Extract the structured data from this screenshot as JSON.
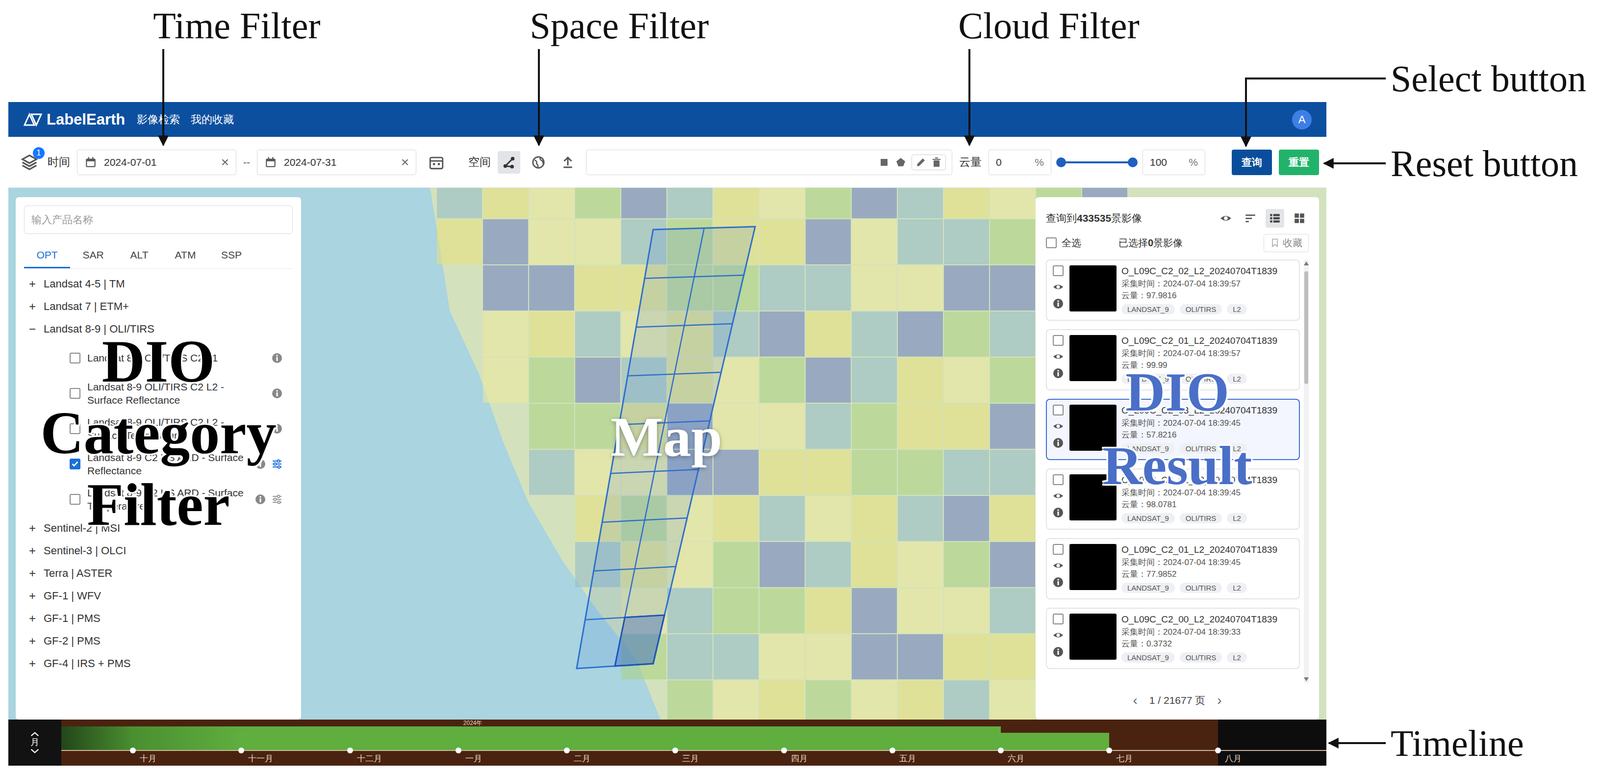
{
  "annotations": {
    "top": [
      {
        "text": "Time Filter"
      },
      {
        "text": "Space Filter"
      },
      {
        "text": "Cloud Filter"
      }
    ],
    "right": [
      {
        "text": "Select button"
      },
      {
        "text": "Reset button"
      },
      {
        "text": "Timeline"
      }
    ],
    "overlays": {
      "category": "DIO Category Filter",
      "map": "Map",
      "result": "DIO Result"
    }
  },
  "header": {
    "logo": "LabelEarth",
    "nav": [
      "影像检索",
      "我的收藏"
    ],
    "avatar": "A"
  },
  "toolbar": {
    "layer_badge": "1",
    "time": {
      "label": "时间",
      "start": "2024-07-01",
      "end": "2024-07-31",
      "separator": "--",
      "clear": "×"
    },
    "space": {
      "label": "空间",
      "modes": [
        {
          "selected": true
        },
        {
          "selected": false
        },
        {
          "selected": false
        }
      ]
    },
    "cloud": {
      "label": "云量",
      "min": "0",
      "max": "100",
      "unit": "%",
      "from": 0,
      "level": 1
    },
    "buttons": {
      "query": "查询",
      "reset": "重置"
    }
  },
  "category": {
    "search_placeholder": "输入产品名称",
    "tabs": [
      {
        "label": "OPT",
        "selected": true
      },
      {
        "label": "SAR",
        "selected": false
      },
      {
        "label": "ALT",
        "selected": false
      },
      {
        "label": "ATM",
        "selected": false
      },
      {
        "label": "SSP",
        "selected": false
      }
    ],
    "groups": [
      {
        "sign": "+",
        "name": "Landsat 4-5 | TM",
        "expanded": false,
        "items": []
      },
      {
        "sign": "+",
        "name": "Landsat 7 | ETM+",
        "expanded": false,
        "items": []
      },
      {
        "sign": "−",
        "name": "Landsat 8-9 | OLI/TIRS",
        "expanded": true,
        "items": [
          {
            "name": "Landsat 8-9 OLI/TIRS C2 L1",
            "checked": false,
            "settings": false
          },
          {
            "name": "Landsat 8-9 OLI/TIRS C2 L2 - Surface Reflectance",
            "checked": false,
            "settings": false
          },
          {
            "name": "Landsat 8-9 OLI/TIRS C2 L2 - Surface Temperature",
            "checked": false,
            "settings": false
          },
          {
            "name": "Landsat 8-9 C2 US ARD - Surface Reflectance",
            "checked": true,
            "settings": true
          },
          {
            "name": "Landsat 8-9 C2 US ARD - Surface Temperature",
            "checked": false,
            "settings": true
          }
        ]
      },
      {
        "sign": "+",
        "name": "Sentinel-2 | MSI",
        "expanded": false,
        "items": []
      },
      {
        "sign": "+",
        "name": "Sentinel-3 | OLCI",
        "expanded": false,
        "items": []
      },
      {
        "sign": "+",
        "name": "Terra | ASTER",
        "expanded": false,
        "items": []
      },
      {
        "sign": "+",
        "name": "GF-1 | WFV",
        "expanded": false,
        "items": []
      },
      {
        "sign": "+",
        "name": "GF-1 | PMS",
        "expanded": false,
        "items": []
      },
      {
        "sign": "+",
        "name": "GF-2 | PMS",
        "expanded": false,
        "items": []
      },
      {
        "sign": "+",
        "name": "GF-4 | IRS + PMS",
        "expanded": false,
        "items": []
      }
    ]
  },
  "results": {
    "count_prefix": "查询到",
    "count": "433535",
    "count_suffix": "景影像",
    "views": [
      {
        "selected": true
      },
      {
        "selected": false
      }
    ],
    "select_all": {
      "label": "全选",
      "checked": false
    },
    "picked_prefix": "已选择",
    "picked": "0",
    "picked_suffix": "景影像",
    "favorite": {
      "label": "收藏",
      "disabled": true
    },
    "time_label": "采集时间：",
    "cloud_label": "云量：",
    "items": [
      {
        "title": "O_L09C_C2_02_L2_20240704T1839",
        "time": "2024-07-04 18:39:57",
        "cloud": "97.9816",
        "tags": [
          "LANDSAT_9",
          "OLI/TIRS",
          "L2"
        ],
        "checked": false,
        "selected": false
      },
      {
        "title": "O_L09C_C2_01_L2_20240704T1839",
        "time": "2024-07-04 18:39:57",
        "cloud": "99.99",
        "tags": [
          "LANDSAT_9",
          "OLI/TIRS",
          "L2"
        ],
        "checked": false,
        "selected": false
      },
      {
        "title": "O_L09C_C2_03_L2_20240704T1839",
        "time": "2024-07-04 18:39:45",
        "cloud": "57.8216",
        "tags": [
          "LANDSAT_9",
          "OLI/TIRS",
          "L2"
        ],
        "checked": false,
        "selected": true
      },
      {
        "title": "O_L09C_C2_02_L2_20240704T1839",
        "time": "2024-07-04 18:39:45",
        "cloud": "98.0781",
        "tags": [
          "LANDSAT_9",
          "OLI/TIRS",
          "L2"
        ],
        "checked": false,
        "selected": false
      },
      {
        "title": "O_L09C_C2_01_L2_20240704T1839",
        "time": "2024-07-04 18:39:45",
        "cloud": "77.9852",
        "tags": [
          "LANDSAT_9",
          "OLI/TIRS",
          "L2"
        ],
        "checked": false,
        "selected": false
      },
      {
        "title": "O_L09C_C2_00_L2_20240704T1839",
        "time": "2024-07-04 18:39:33",
        "cloud": "0.3732",
        "tags": [
          "LANDSAT_9",
          "OLI/TIRS",
          "L2"
        ],
        "checked": false,
        "selected": false
      }
    ],
    "page": {
      "prev": "‹",
      "text": "1 / 21677 页",
      "next": "›"
    }
  },
  "timeline": {
    "unit": "月",
    "months": [
      {
        "label": "十月",
        "level": 0.77,
        "future": false
      },
      {
        "label": "十一月",
        "level": 0.77,
        "future": false
      },
      {
        "label": "十二月",
        "level": 0.77,
        "future": false
      },
      {
        "label": "一月",
        "level": 0.77,
        "future": false,
        "year": "2024年"
      },
      {
        "label": "二月",
        "level": 0.77,
        "future": false
      },
      {
        "label": "三月",
        "level": 0.77,
        "future": false
      },
      {
        "label": "四月",
        "level": 0.77,
        "future": false
      },
      {
        "label": "五月",
        "level": 0.77,
        "future": false
      },
      {
        "label": "六月",
        "level": 0.57,
        "future": false
      },
      {
        "label": "七月",
        "level": 0,
        "future": false
      },
      {
        "label": "八月",
        "level": 0,
        "future": true
      }
    ]
  }
}
